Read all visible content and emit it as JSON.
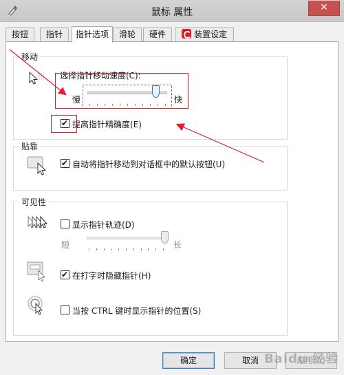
{
  "window": {
    "title": "鼠标 属性",
    "close_glyph": "✕"
  },
  "tabs": [
    {
      "label": "按钮"
    },
    {
      "label": "指针"
    },
    {
      "label": "指针选项"
    },
    {
      "label": "滑轮"
    },
    {
      "label": "硬件"
    },
    {
      "label": "装置设定值"
    }
  ],
  "motion": {
    "title": "移动",
    "speed_label": "选择指针移动速度(C):",
    "slow": "慢",
    "fast": "快",
    "speed_level": 0.86,
    "precision_label": "提高指针精确度(E)",
    "precision_checked": true
  },
  "snap": {
    "title": "贴靠",
    "label": "自动将指针移动到对话框中的默认按钮(U)",
    "checked": true
  },
  "visibility": {
    "title": "可见性",
    "trails_label": "显示指针轨迹(D)",
    "trails_checked": false,
    "short": "短",
    "long": "长",
    "trail_level": 1.0,
    "hide_label": "在打字时隐藏指针(H)",
    "hide_checked": true,
    "ctrl_label": "当按 CTRL 键时显示指针的位置(S)",
    "ctrl_checked": false
  },
  "buttons": {
    "ok": "确定",
    "cancel": "取消",
    "apply": "应用(A)"
  },
  "watermark": "Baidu 经验",
  "colors": {
    "annotation": "#e0202a",
    "accent": "#3c7fb1",
    "close": "#c75050"
  }
}
